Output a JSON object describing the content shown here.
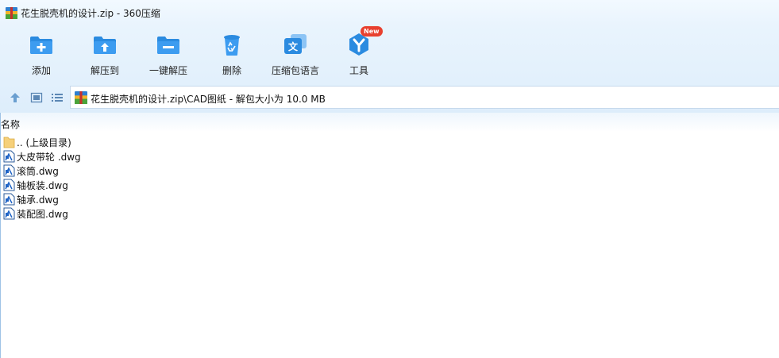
{
  "window": {
    "title": "花生脱壳机的设计.zip - 360压缩"
  },
  "toolbar": [
    {
      "label": "添加",
      "icon": "add-folder-icon"
    },
    {
      "label": "解压到",
      "icon": "extract-to-icon"
    },
    {
      "label": "一键解压",
      "icon": "one-click-extract-icon"
    },
    {
      "label": "删除",
      "icon": "recycle-bin-icon"
    },
    {
      "label": "压缩包语言",
      "icon": "language-icon"
    },
    {
      "label": "工具",
      "icon": "tools-icon",
      "badge": "New"
    }
  ],
  "address": {
    "path": "花生脱壳机的设计.zip\\CAD图纸 - 解包大小为 10.0 MB"
  },
  "list": {
    "column_name": "名称",
    "items": [
      {
        "name": ".. (上级目录)",
        "icon": "folder-up-icon"
      },
      {
        "name": "大皮带轮 .dwg",
        "icon": "dwg-file-icon"
      },
      {
        "name": "滚筒.dwg",
        "icon": "dwg-file-icon"
      },
      {
        "name": "轴板装.dwg",
        "icon": "dwg-file-icon"
      },
      {
        "name": "轴承.dwg",
        "icon": "dwg-file-icon"
      },
      {
        "name": "装配图.dwg",
        "icon": "dwg-file-icon"
      }
    ]
  },
  "colors": {
    "accent": "#2b8be0",
    "toolbar_bg": "#e4f1fc",
    "badge": "#e8402f"
  }
}
